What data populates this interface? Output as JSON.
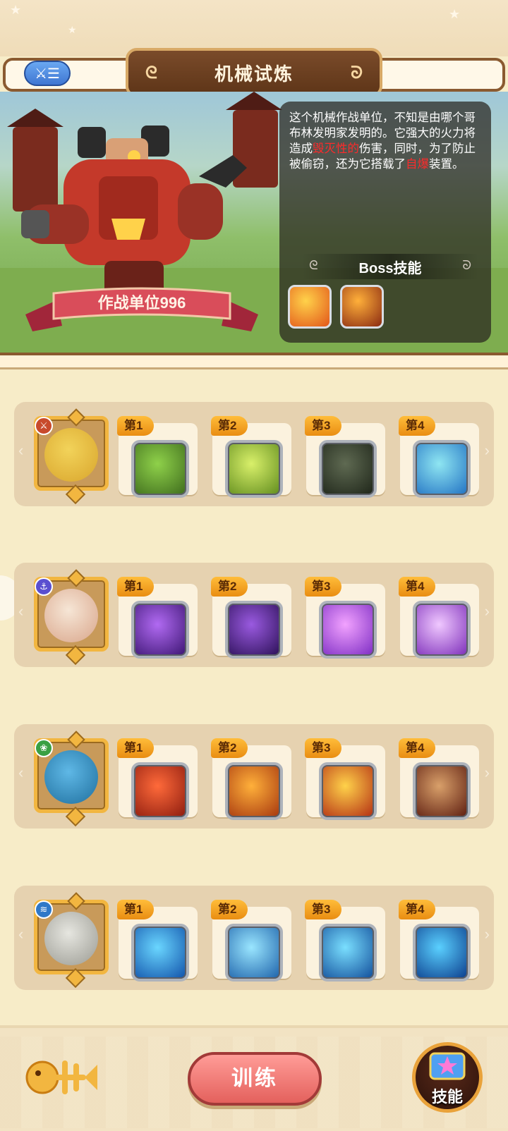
{
  "header": {
    "title": "机械试炼",
    "menu_icon": "list-toggle-icon"
  },
  "boss": {
    "name": "作战单位996",
    "description_parts": [
      {
        "text": "这个机械作战单位，不知是由哪个哥布林发明家发明的。它强大的火力将造成",
        "highlight": false
      },
      {
        "text": "毁灭性的",
        "highlight": true
      },
      {
        "text": "伤害，同时，为了防止被偷窃，还为它搭载了",
        "highlight": false
      },
      {
        "text": "自爆",
        "highlight": true
      },
      {
        "text": "装置。",
        "highlight": false
      }
    ],
    "skills_title": "Boss技能",
    "skills": [
      {
        "icon": "fire-claw-icon",
        "colors": [
          "#ffd24a",
          "#e2561a"
        ]
      },
      {
        "icon": "explosion-silhouette-icon",
        "colors": [
          "#ffb03a",
          "#8a2a12"
        ]
      }
    ]
  },
  "rows": [
    {
      "hero": {
        "icon": "yellow-hero-avatar",
        "badge": "crossed-swords-icon",
        "badge_color": "#c84a2c",
        "face": [
          "#f2d35a",
          "#d9a52c"
        ]
      },
      "slots": [
        {
          "label": "第1",
          "icon": "spiked-hammer-icon",
          "colors": [
            "#8fd14a",
            "#3d6a1c"
          ]
        },
        {
          "label": "第2",
          "icon": "golden-shield-icon",
          "colors": [
            "#d9f06a",
            "#5e8a1c"
          ]
        },
        {
          "label": "第3",
          "icon": "dark-shield-icon",
          "colors": [
            "#5f6a52",
            "#1d2418"
          ]
        },
        {
          "label": "第4",
          "icon": "water-slash-icon",
          "colors": [
            "#8fe6f2",
            "#1f6fc2"
          ]
        }
      ]
    },
    {
      "hero": {
        "icon": "crowned-hero-avatar",
        "badge": "anchor-icon",
        "badge_color": "#5a4fd0",
        "face": [
          "#f6e6d6",
          "#d9a58a"
        ]
      },
      "slots": [
        {
          "label": "第1",
          "icon": "purple-plant-icon",
          "colors": [
            "#b16af2",
            "#3a1470"
          ]
        },
        {
          "label": "第2",
          "icon": "shadow-figure-icon",
          "colors": [
            "#9a5ae0",
            "#2a0f55"
          ]
        },
        {
          "label": "第3",
          "icon": "winged-cross-shield-icon",
          "colors": [
            "#f2a2ff",
            "#7a2ac2"
          ]
        },
        {
          "label": "第4",
          "icon": "purple-swirl-icon",
          "colors": [
            "#f0c8ff",
            "#7a2ab8"
          ]
        }
      ]
    },
    {
      "hero": {
        "icon": "blue-fish-hero-avatar",
        "badge": "leaf-icon",
        "badge_color": "#3aa043",
        "face": [
          "#5fb8e6",
          "#1f6f9e"
        ]
      },
      "slots": [
        {
          "label": "第1",
          "icon": "spiked-mace-icon",
          "colors": [
            "#ff6a3a",
            "#8a1a0e"
          ]
        },
        {
          "label": "第2",
          "icon": "fire-feathers-icon",
          "colors": [
            "#ffb03a",
            "#a4340e"
          ]
        },
        {
          "label": "第3",
          "icon": "campfire-icon",
          "colors": [
            "#ffd24a",
            "#b12a12"
          ]
        },
        {
          "label": "第4",
          "icon": "crossbow-icon",
          "colors": [
            "#d9a06a",
            "#5a1a0e"
          ]
        }
      ]
    },
    {
      "hero": {
        "icon": "bandaged-hero-avatar",
        "badge": "wind-icon",
        "badge_color": "#2f78c8",
        "face": [
          "#e6e6e0",
          "#9a9a92"
        ]
      },
      "slots": [
        {
          "label": "第1",
          "icon": "snowflake-icon",
          "colors": [
            "#6ad6ff",
            "#0f4fa8"
          ]
        },
        {
          "label": "第2",
          "icon": "ice-spear-icon",
          "colors": [
            "#9ae6ff",
            "#1a5fa8"
          ]
        },
        {
          "label": "第3",
          "icon": "ice-crystals-icon",
          "colors": [
            "#7adfff",
            "#0f4a98"
          ]
        },
        {
          "label": "第4",
          "icon": "ice-shard-icon",
          "colors": [
            "#5ad0ff",
            "#0a3a8a"
          ]
        }
      ]
    }
  ],
  "bottom": {
    "fishbone_icon": "fishbone-icon",
    "train_label": "训练",
    "skill_label": "技能",
    "skill_icon": "skill-book-icon"
  }
}
